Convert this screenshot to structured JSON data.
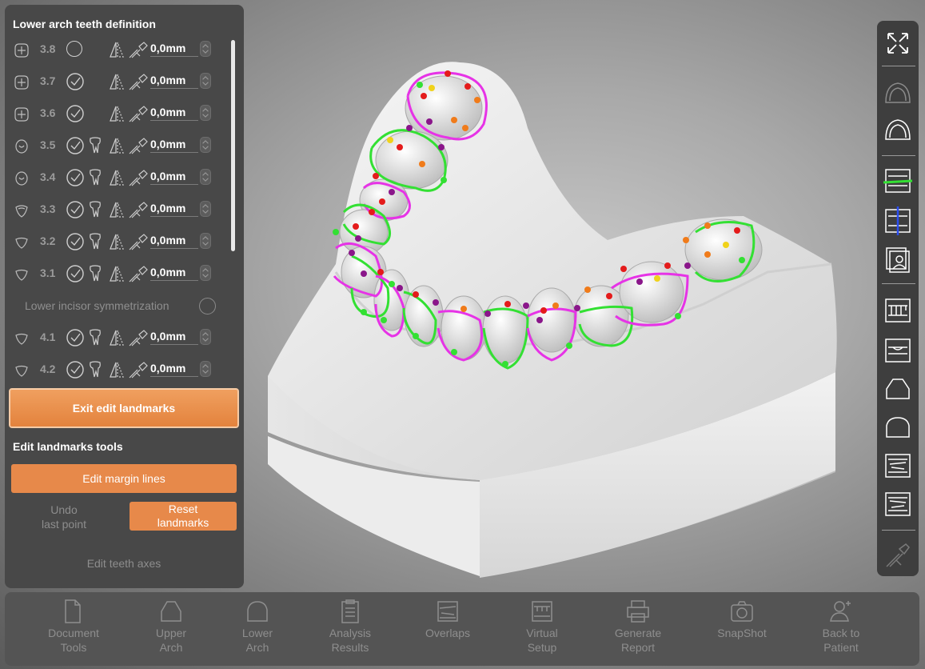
{
  "panel": {
    "title": "Lower arch teeth definition",
    "teeth": [
      {
        "num": "3.8",
        "status": "empty",
        "value": "0,0mm",
        "root": false,
        "icon": "molar-occlusal-icon"
      },
      {
        "num": "3.7",
        "status": "check",
        "value": "0,0mm",
        "root": false,
        "icon": "molar-occlusal-icon"
      },
      {
        "num": "3.6",
        "status": "check",
        "value": "0,0mm",
        "root": false,
        "icon": "molar-occlusal-icon"
      },
      {
        "num": "3.5",
        "status": "check",
        "value": "0,0mm",
        "root": true,
        "icon": "premolar-occlusal-icon"
      },
      {
        "num": "3.4",
        "status": "check",
        "value": "0,0mm",
        "root": true,
        "icon": "premolar-occlusal-icon"
      },
      {
        "num": "3.3",
        "status": "check",
        "value": "0,0mm",
        "root": true,
        "icon": "canine-occlusal-icon"
      },
      {
        "num": "3.2",
        "status": "check",
        "value": "0,0mm",
        "root": true,
        "icon": "incisor-occlusal-icon"
      },
      {
        "num": "3.1",
        "status": "check",
        "value": "0,0mm",
        "root": true,
        "icon": "incisor-occlusal-icon"
      }
    ],
    "symmetrization_label": "Lower incisor symmetrization",
    "teeth_after": [
      {
        "num": "4.1",
        "status": "check",
        "value": "0,0mm",
        "root": true,
        "icon": "incisor-occlusal-icon"
      },
      {
        "num": "4.2",
        "status": "check",
        "value": "0,0mm",
        "root": true,
        "icon": "incisor-occlusal-icon"
      }
    ],
    "exit_button": "Exit edit landmarks",
    "tools_title": "Edit landmarks tools",
    "edit_margin_button": "Edit margin lines",
    "undo_line1": "Undo",
    "undo_line2": "last point",
    "reset_line1": "Reset",
    "reset_line2": "landmarks",
    "edit_axes": "Edit teeth axes"
  },
  "right_toolbar": [
    "fullscreen-icon",
    "upper-arch-view-icon",
    "lower-arch-view-icon",
    "occlusal-plane-icon",
    "midline-icon",
    "photos-icon",
    "front-view-icon",
    "bite-view-icon",
    "upper-outline-icon",
    "lower-outline-icon",
    "left-side-view-icon",
    "right-side-view-icon",
    "measure-tool-icon"
  ],
  "bottom_bar": [
    {
      "line1": "Document",
      "line2": "Tools",
      "icon": "document-icon"
    },
    {
      "line1": "Upper",
      "line2": "Arch",
      "icon": "upper-arch-icon"
    },
    {
      "line1": "Lower",
      "line2": "Arch",
      "icon": "lower-arch-icon"
    },
    {
      "line1": "Analysis",
      "line2": "Results",
      "icon": "clipboard-icon"
    },
    {
      "line1": "Overlaps",
      "line2": "",
      "icon": "overlaps-icon"
    },
    {
      "line1": "Virtual",
      "line2": "Setup",
      "icon": "virtual-setup-icon"
    },
    {
      "line1": "Generate",
      "line2": "Report",
      "icon": "printer-icon"
    },
    {
      "line1": "SnapShot",
      "line2": "",
      "icon": "camera-icon"
    },
    {
      "line1": "Back to",
      "line2": "Patient",
      "icon": "patient-icon"
    }
  ],
  "colors": {
    "accent": "#e7894a",
    "margin_green": "#33e033",
    "margin_magenta": "#e633e6",
    "landmark_red": "#e41b1b",
    "landmark_orange": "#f07b1a",
    "landmark_purple": "#8a168a",
    "landmark_yellow": "#f0d21a"
  }
}
